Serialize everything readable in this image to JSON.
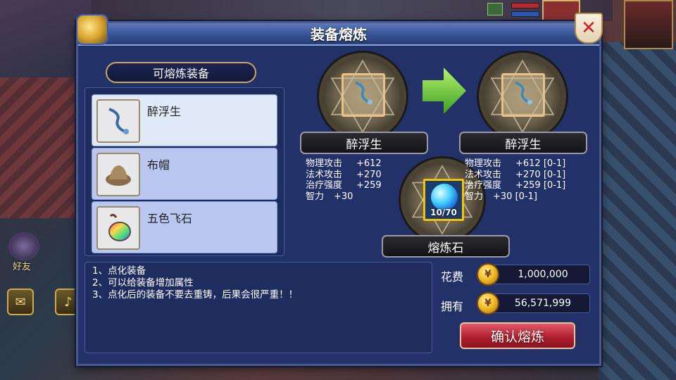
{
  "window": {
    "title": "装备熔炼",
    "close_icon": "close-icon"
  },
  "list": {
    "header": "可熔炼装备",
    "items": [
      {
        "name": "醉浮生",
        "icon": "sword-icon",
        "selected": true
      },
      {
        "name": "布帽",
        "icon": "hat-icon",
        "selected": false
      },
      {
        "name": "五色飞石",
        "icon": "stone-icon",
        "selected": false
      }
    ]
  },
  "left_equip": {
    "name": "醉浮生",
    "stats": [
      {
        "key": "物理攻击",
        "value": "+612"
      },
      {
        "key": "法术攻击",
        "value": "+270"
      },
      {
        "key": "治疗强度",
        "value": "+259"
      },
      {
        "key": "智力",
        "value": "+30"
      }
    ]
  },
  "right_equip": {
    "name": "醉浮生",
    "stats": [
      {
        "key": "物理攻击",
        "value": "+612 [0-1]"
      },
      {
        "key": "法术攻击",
        "value": "+270 [0-1]"
      },
      {
        "key": "治疗强度",
        "value": "+259 [0-1]"
      },
      {
        "key": "智力",
        "value": "+30 [0-1]"
      }
    ]
  },
  "stone": {
    "name": "熔炼石",
    "count": "10/70"
  },
  "notes": [
    "1、点化装备",
    "2、可以给装备增加属性",
    "3、点化后的装备不要去重铸，后果会很严重！！"
  ],
  "cost": {
    "cost_label": "花费",
    "cost_value": "1,000,000",
    "own_label": "拥有",
    "own_value": "56,571,999"
  },
  "confirm_button": "确认熔炼",
  "hud": {
    "friend_label": "好友"
  },
  "colors": {
    "panel_bg": "#223268",
    "selected_item": "#dfe9f8",
    "item_bg": "#b9c6f0",
    "confirm_button": "#b0202e",
    "stone_border": "#f0c400"
  }
}
